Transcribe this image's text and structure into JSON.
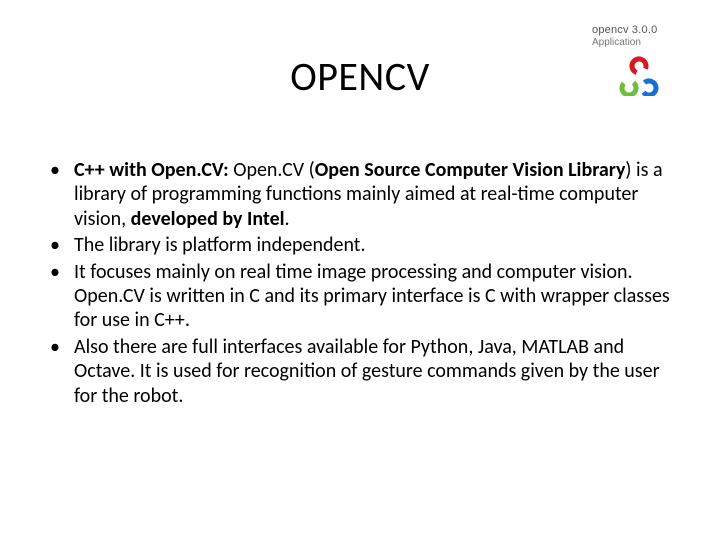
{
  "logo": {
    "text": "opencv 3.0.0",
    "subtext": "Application"
  },
  "title": "OPENCV",
  "bullets": {
    "b1": {
      "lead": "C++ with Open.CV:",
      "mid1": " Open.CV (",
      "bold1": "Open Source Computer Vision Library",
      "mid2": ") is a library of programming functions mainly aimed at real-time computer vision, ",
      "bold2": "developed by Intel",
      "tail": "."
    },
    "b2": "The library is platform independent.",
    "b3": " It focuses mainly on real time image processing and computer vision. Open.CV is written in C and its primary interface is C with wrapper classes for use in C++.",
    "b4": "Also there are full interfaces available for Python, Java, MATLAB and Octave. It is used for recognition of gesture commands given by the user for the robot."
  }
}
